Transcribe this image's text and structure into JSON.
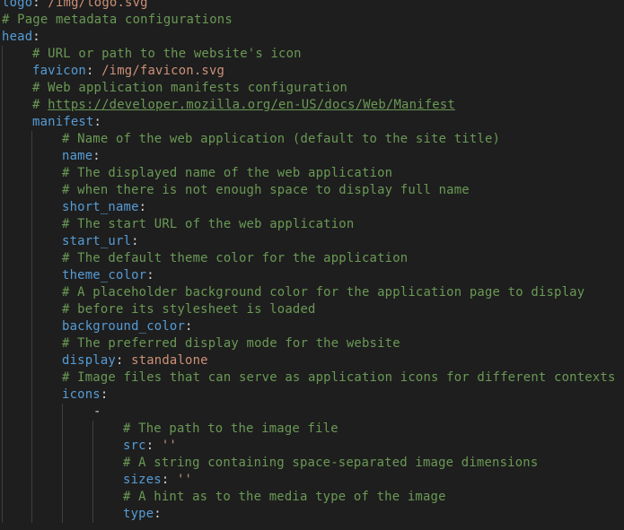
{
  "lines": [
    {
      "indent": 0,
      "parts": [
        {
          "t": "key",
          "v": "logo"
        },
        {
          "t": "punct",
          "v": ": "
        },
        {
          "t": "str",
          "v": "/img/logo.svg"
        }
      ]
    },
    {
      "indent": 0,
      "parts": [
        {
          "t": "comment",
          "v": "# Page metadata configurations"
        }
      ]
    },
    {
      "indent": 0,
      "parts": [
        {
          "t": "key",
          "v": "head"
        },
        {
          "t": "punct",
          "v": ":"
        }
      ]
    },
    {
      "indent": 1,
      "parts": [
        {
          "t": "comment",
          "v": "# URL or path to the website's icon"
        }
      ]
    },
    {
      "indent": 1,
      "parts": [
        {
          "t": "key",
          "v": "favicon"
        },
        {
          "t": "punct",
          "v": ": "
        },
        {
          "t": "str",
          "v": "/img/favicon.svg"
        }
      ]
    },
    {
      "indent": 1,
      "parts": [
        {
          "t": "comment",
          "v": "# Web application manifests configuration"
        }
      ]
    },
    {
      "indent": 1,
      "parts": [
        {
          "t": "comment",
          "v": "# "
        },
        {
          "t": "link",
          "v": "https://developer.mozilla.org/en-US/docs/Web/Manifest"
        }
      ]
    },
    {
      "indent": 1,
      "parts": [
        {
          "t": "key",
          "v": "manifest"
        },
        {
          "t": "punct",
          "v": ":"
        }
      ]
    },
    {
      "indent": 2,
      "parts": [
        {
          "t": "comment",
          "v": "# Name of the web application (default to the site title)"
        }
      ]
    },
    {
      "indent": 2,
      "parts": [
        {
          "t": "key",
          "v": "name"
        },
        {
          "t": "punct",
          "v": ":"
        }
      ]
    },
    {
      "indent": 2,
      "parts": [
        {
          "t": "comment",
          "v": "# The displayed name of the web application"
        }
      ]
    },
    {
      "indent": 2,
      "parts": [
        {
          "t": "comment",
          "v": "# when there is not enough space to display full name"
        }
      ]
    },
    {
      "indent": 2,
      "parts": [
        {
          "t": "key",
          "v": "short_name"
        },
        {
          "t": "punct",
          "v": ":"
        }
      ]
    },
    {
      "indent": 2,
      "parts": [
        {
          "t": "comment",
          "v": "# The start URL of the web application"
        }
      ]
    },
    {
      "indent": 2,
      "parts": [
        {
          "t": "key",
          "v": "start_url"
        },
        {
          "t": "punct",
          "v": ":"
        }
      ]
    },
    {
      "indent": 2,
      "parts": [
        {
          "t": "comment",
          "v": "# The default theme color for the application"
        }
      ]
    },
    {
      "indent": 2,
      "parts": [
        {
          "t": "key",
          "v": "theme_color"
        },
        {
          "t": "punct",
          "v": ":"
        }
      ]
    },
    {
      "indent": 2,
      "parts": [
        {
          "t": "comment",
          "v": "# A placeholder background color for the application page to display"
        }
      ]
    },
    {
      "indent": 2,
      "parts": [
        {
          "t": "comment",
          "v": "# before its stylesheet is loaded"
        }
      ]
    },
    {
      "indent": 2,
      "parts": [
        {
          "t": "key",
          "v": "background_color"
        },
        {
          "t": "punct",
          "v": ":"
        }
      ]
    },
    {
      "indent": 2,
      "parts": [
        {
          "t": "comment",
          "v": "# The preferred display mode for the website"
        }
      ]
    },
    {
      "indent": 2,
      "parts": [
        {
          "t": "key",
          "v": "display"
        },
        {
          "t": "punct",
          "v": ": "
        },
        {
          "t": "str",
          "v": "standalone"
        }
      ]
    },
    {
      "indent": 2,
      "parts": [
        {
          "t": "comment",
          "v": "# Image files that can serve as application icons for different contexts"
        }
      ]
    },
    {
      "indent": 2,
      "parts": [
        {
          "t": "key",
          "v": "icons"
        },
        {
          "t": "punct",
          "v": ":"
        }
      ]
    },
    {
      "indent": 3,
      "parts": [
        {
          "t": "punct",
          "v": "-"
        }
      ]
    },
    {
      "indent": 4,
      "parts": [
        {
          "t": "comment",
          "v": "# The path to the image file"
        }
      ]
    },
    {
      "indent": 4,
      "parts": [
        {
          "t": "key",
          "v": "src"
        },
        {
          "t": "punct",
          "v": ": "
        },
        {
          "t": "str",
          "v": "''"
        }
      ]
    },
    {
      "indent": 4,
      "parts": [
        {
          "t": "comment",
          "v": "# A string containing space-separated image dimensions"
        }
      ]
    },
    {
      "indent": 4,
      "parts": [
        {
          "t": "key",
          "v": "sizes"
        },
        {
          "t": "punct",
          "v": ": "
        },
        {
          "t": "str",
          "v": "''"
        }
      ]
    },
    {
      "indent": 4,
      "parts": [
        {
          "t": "comment",
          "v": "# A hint as to the media type of the image"
        }
      ]
    },
    {
      "indent": 4,
      "parts": [
        {
          "t": "key",
          "v": "type"
        },
        {
          "t": "punct",
          "v": ":"
        }
      ]
    }
  ]
}
